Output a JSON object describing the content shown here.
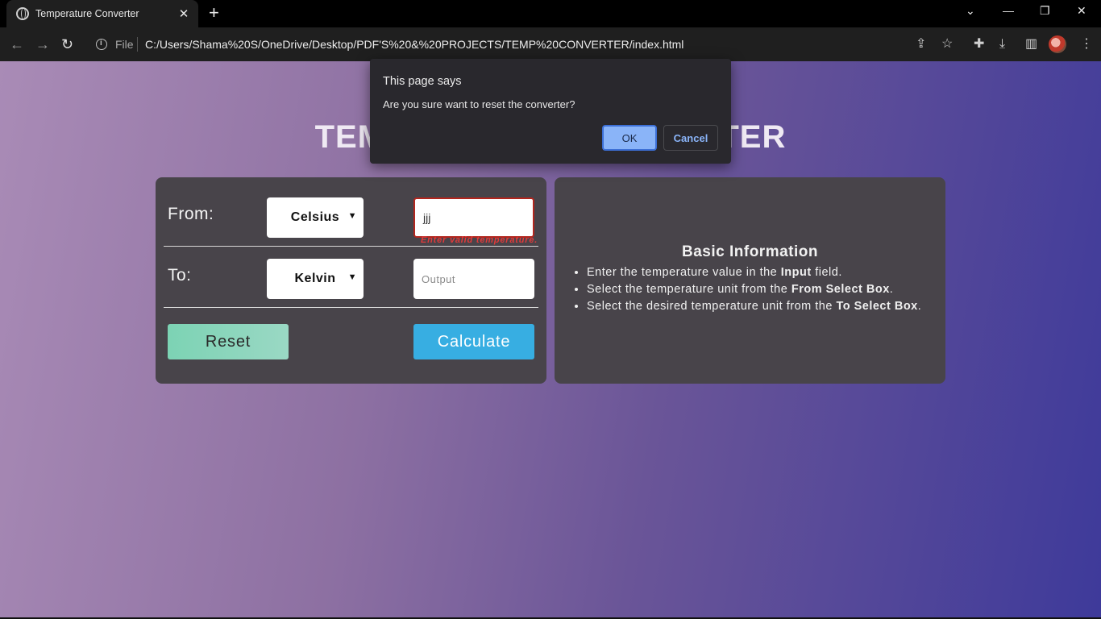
{
  "browser": {
    "tab_title": "Temperature Converter",
    "url_scheme_label": "File",
    "url": "C:/Users/Shama%20S/OneDrive/Desktop/PDF'S%20&%20PROJECTS/TEMP%20CONVERTER/index.html",
    "icons": [
      "globe-icon",
      "close-icon",
      "plus-icon",
      "chevron-down-icon",
      "minimize-icon",
      "restore-icon",
      "close-window-icon",
      "back-icon",
      "forward-icon",
      "reload-icon",
      "info-icon",
      "share-icon",
      "star-icon",
      "extensions-icon",
      "download-icon",
      "sidepanel-icon",
      "avatar",
      "menu-icon"
    ]
  },
  "page": {
    "heading": "TEMPERATURE CONVERTER",
    "from_label": "From:",
    "to_label": "To:",
    "from_select": "Celsius",
    "to_select": "Kelvin",
    "input_value": "jjj",
    "input_error": "Enter valid temperature.",
    "output_placeholder": "Output",
    "reset_label": "Reset",
    "calculate_label": "Calculate"
  },
  "info": {
    "title": "Basic Information",
    "items": [
      {
        "pre": "Enter the temperature value in the ",
        "bold": "Input",
        "post": " field."
      },
      {
        "pre": "Select the temperature unit from the ",
        "bold": "From Select Box",
        "post": "."
      },
      {
        "pre": "Select the desired temperature unit from the ",
        "bold": "To Select Box",
        "post": "."
      }
    ]
  },
  "dialog": {
    "title": "This page says",
    "message": "Are you sure want to reset the converter?",
    "ok_label": "OK",
    "cancel_label": "Cancel"
  },
  "colors": {
    "reset_button": "#7cd3b4",
    "calculate_button": "#37aee2",
    "error": "#e23a3a",
    "card": "#48444a",
    "dialog_ok": "#8ab4f8"
  }
}
